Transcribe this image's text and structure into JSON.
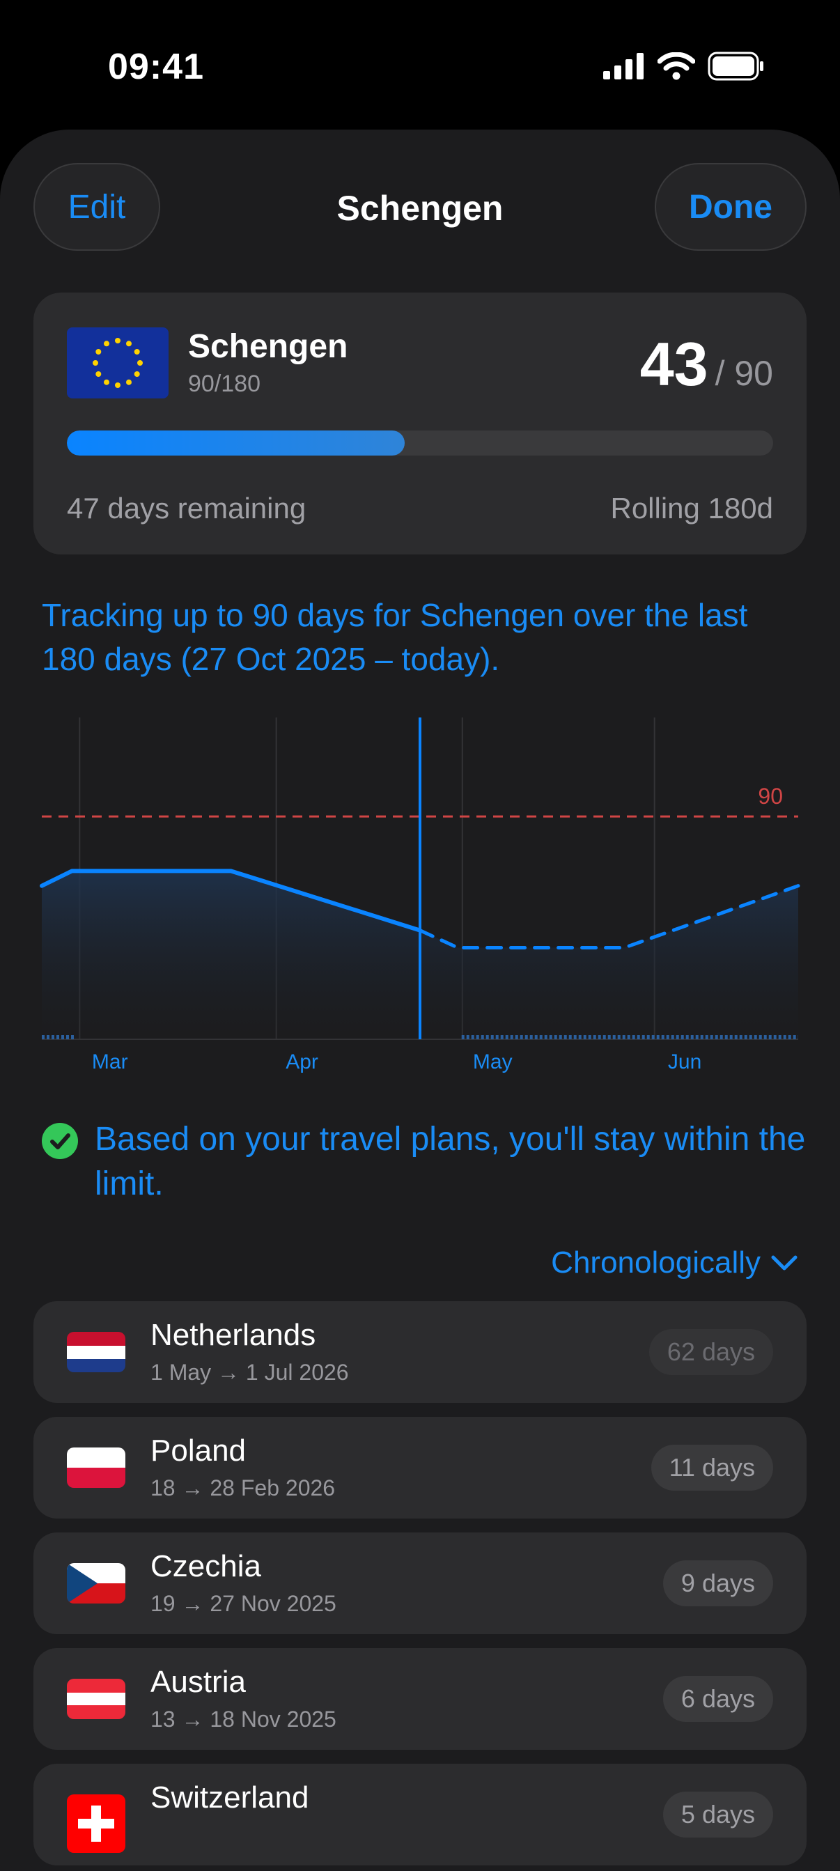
{
  "status_bar": {
    "time": "09:41"
  },
  "nav": {
    "edit_label": "Edit",
    "title": "Schengen",
    "done_label": "Done"
  },
  "summary": {
    "zone_name": "Schengen",
    "rule": "90/180",
    "days_used": "43",
    "limit_label": "/ 90",
    "progress_fraction": 0.478,
    "remaining_text": "47 days remaining",
    "mode_text": "Rolling 180d"
  },
  "tracking_text": "Tracking up to 90 days for Schengen over the last 180 days (27 Oct 2025 – today).",
  "chart_data": {
    "type": "area",
    "x_tick_labels": [
      "Mar",
      "Apr",
      "May",
      "Jun"
    ],
    "limit_label": "90",
    "limit_value": 90,
    "ylim": [
      0,
      130
    ],
    "series": [
      {
        "style": "solid",
        "values": [
          [
            0,
            62
          ],
          [
            0.04,
            68
          ],
          [
            0.25,
            68
          ],
          [
            0.5,
            44
          ]
        ]
      },
      {
        "style": "dashed",
        "values": [
          [
            0.5,
            44
          ],
          [
            0.55,
            37
          ],
          [
            0.77,
            37
          ],
          [
            1.0,
            62
          ]
        ]
      }
    ],
    "today_fraction": 0.5,
    "colors": {
      "line": "#0a84ff",
      "limit": "#d04545"
    }
  },
  "status_message": "Based on your travel plans, you'll stay within the limit.",
  "sort_label": "Chronologically",
  "trips": [
    {
      "country": "Netherlands",
      "dates": "1 May → 1 Jul 2026",
      "duration": "62 days",
      "flag": "netherlands-flag"
    },
    {
      "country": "Poland",
      "dates": "18 → 28 Feb 2026",
      "duration": "11 days",
      "flag": "poland-flag"
    },
    {
      "country": "Czechia",
      "dates": "19 → 27 Nov 2025",
      "duration": "9 days",
      "flag": "czechia-flag"
    },
    {
      "country": "Austria",
      "dates": "13 → 18 Nov 2025",
      "duration": "6 days",
      "flag": "austria-flag"
    },
    {
      "country": "Switzerland",
      "dates": "",
      "duration": "5 days",
      "flag": "switzerland-flag"
    }
  ]
}
